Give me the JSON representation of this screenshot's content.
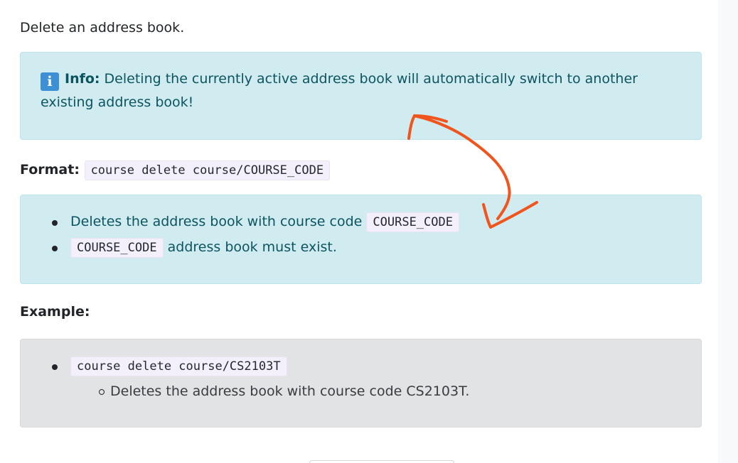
{
  "intro": "Delete an address book.",
  "info_box": {
    "icon": "info-icon",
    "label": "Info:",
    "text": " Deleting the currently active address book will automatically switch to another existing address book!"
  },
  "format": {
    "label": "Format:",
    "code": "course delete course/COURSE_CODE"
  },
  "notes": {
    "item1_text": "Deletes the address book with course code ",
    "item1_code": "COURSE_CODE",
    "item2_code": "COURSE_CODE",
    "item2_text": " address book must exist."
  },
  "example": {
    "label": "Example:",
    "code": "course delete course/CS2103T",
    "description": "Deletes the address book with course code CS2103T."
  },
  "colors": {
    "info_bg": "#d1ecf1",
    "info_text": "#0c5460",
    "gray_bg": "#e2e3e5",
    "annotation": "#f0551e"
  }
}
